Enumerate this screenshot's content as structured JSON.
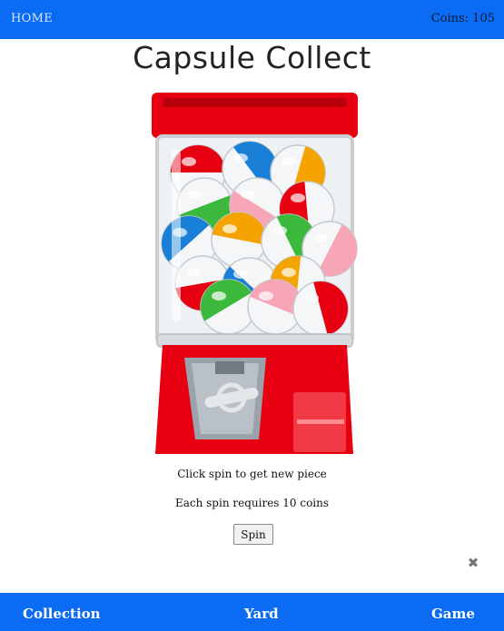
{
  "header": {
    "home_label": "HOME",
    "coins_label": "Coins: 105"
  },
  "main": {
    "title": "Capsule Collect",
    "instructions": "Click spin to get new piece",
    "cost_note": "Each spin requires 10 coins",
    "spin_label": "Spin",
    "machine_image": "gashapon-capsule-machine",
    "close_icon": "close-icon",
    "close_glyph": "✖"
  },
  "footer": {
    "nav": [
      "Collection",
      "Yard",
      "Game"
    ]
  },
  "colors": {
    "bar_blue": "#0b6cf3",
    "machine_red": "#e60012",
    "capsule_colors": [
      "#e60012",
      "#1a7fd6",
      "#f5a300",
      "#3cb83c",
      "#f7a6b8"
    ]
  }
}
